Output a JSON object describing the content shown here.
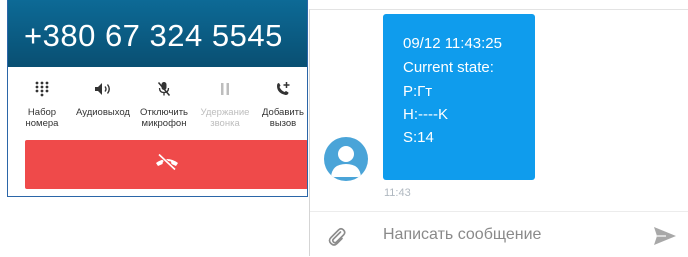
{
  "call": {
    "number": "+380 67 324 5545",
    "actions": [
      {
        "label": "Набор\nномера",
        "icon": "dialpad-icon",
        "disabled": false
      },
      {
        "label": "Аудиовыход",
        "icon": "speaker-icon",
        "disabled": false
      },
      {
        "label": "Отключить\nмикрофон",
        "icon": "mic-off-icon",
        "disabled": false
      },
      {
        "label": "Удержание\nзвонка",
        "icon": "pause-icon",
        "disabled": true
      },
      {
        "label": "Добавить\nвызов",
        "icon": "add-call-icon",
        "disabled": false
      }
    ],
    "end_call_color": "#ef4a4a",
    "header_color": "#0a5d86"
  },
  "chat": {
    "message": {
      "lines": [
        "09/12 11:43:25",
        "Current state:",
        "P:Гт",
        "H:----K",
        "S:14"
      ],
      "time": "11:43"
    },
    "composer": {
      "placeholder": "Написать сообщение"
    },
    "bubble_color": "#0f9ced"
  }
}
